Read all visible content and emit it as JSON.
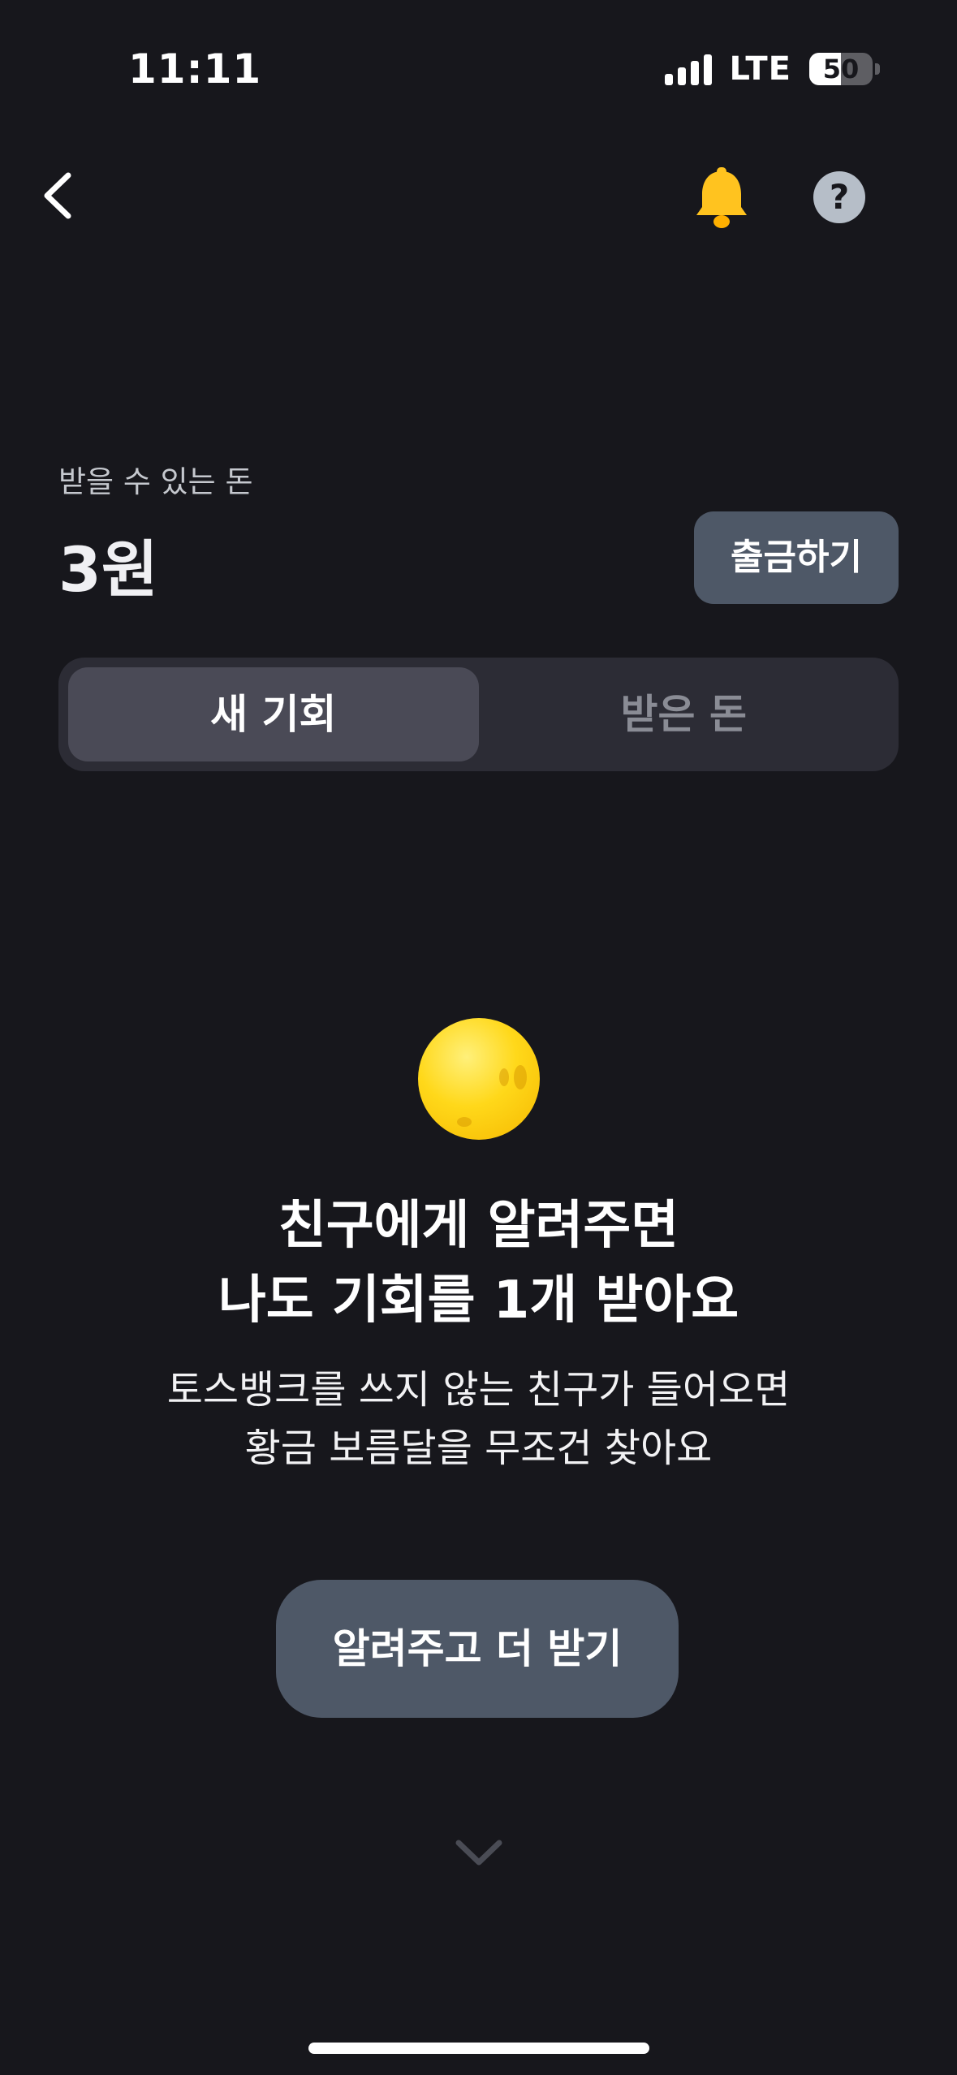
{
  "status_bar": {
    "time": "11:11",
    "network": "LTE",
    "battery": "50",
    "battery_level": 0.5
  },
  "nav": {
    "back_icon": "chevron-left-icon",
    "bell_icon": "bell-icon",
    "help_label": "?"
  },
  "balance": {
    "label": "받을 수 있는 돈",
    "amount": "3원",
    "withdraw_label": "출금하기"
  },
  "tabs": [
    {
      "label": "새 기회",
      "active": true
    },
    {
      "label": "받은 돈",
      "active": false
    }
  ],
  "promo": {
    "icon": "golden-moon-icon",
    "headline_line1": "친구에게 알려주면",
    "headline_line2": "나도 기회를 1개 받아요",
    "sub_line1": "토스뱅크를 쓰지 않는 친구가 들어오면",
    "sub_line2": "황금 보름달을 무조건 찾아요",
    "cta_label": "알려주고 더 받기"
  },
  "colors": {
    "background": "#17171c",
    "bell": "#ffc31f",
    "button": "#4e5867",
    "moon": "#ffd81a"
  }
}
